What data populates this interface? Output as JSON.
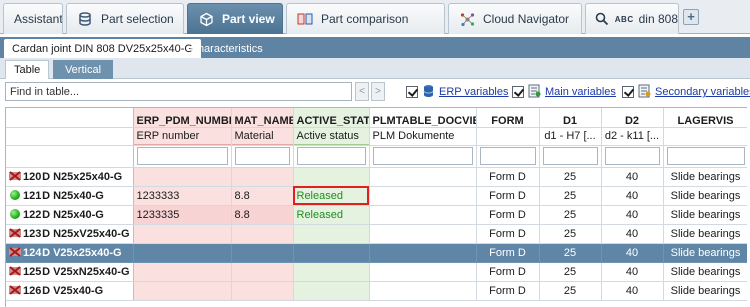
{
  "top_tabs": [
    {
      "label": "Assistant",
      "icon": "none"
    },
    {
      "label": "Part selection",
      "icon": "database-icon"
    },
    {
      "label": "Part view",
      "icon": "cube-icon"
    },
    {
      "label": "Part comparison",
      "icon": "compare-icon"
    },
    {
      "label": "Cloud Navigator",
      "icon": "network-icon"
    },
    {
      "label": "din 808",
      "prefix": "ABC",
      "icon": "search-icon"
    }
  ],
  "add_tab_label": "+",
  "doc_tabs": [
    {
      "label": "Cardan joint DIN 808 DV25x25x40-G"
    },
    {
      "label": "Characteristics"
    }
  ],
  "view_tabs": [
    {
      "label": "Table"
    },
    {
      "label": "Vertical"
    }
  ],
  "search": {
    "placeholder": "Find in table..."
  },
  "nav": {
    "prev": "<",
    "next": ">"
  },
  "options": [
    {
      "label": "ERP variables",
      "checked": true,
      "icon": "erp-db-icon"
    },
    {
      "label": "Main variables",
      "checked": true,
      "icon": "main-vars-icon"
    },
    {
      "label": "Secondary variables",
      "checked": true,
      "icon": "secondary-vars-icon"
    }
  ],
  "table": {
    "columns": [
      {
        "name": "ERP_PDM_NUMBER",
        "desc": "ERP number"
      },
      {
        "name": "MAT_NAME",
        "desc": "Material"
      },
      {
        "name": "ACTIVE_STATE",
        "desc": "Active status"
      },
      {
        "name": "PLMTABLE_DOCVIEW",
        "desc": "PLM Dokumente"
      },
      {
        "name": "FORM",
        "desc": ""
      },
      {
        "name": "D1",
        "desc": "d1 - H7 [..."
      },
      {
        "name": "D2",
        "desc": "d2 - k11 [..."
      },
      {
        "name": "LAGERVIS",
        "desc": ""
      }
    ],
    "rows": [
      {
        "num": "120",
        "status": "invalid",
        "name": "D N25x25x40-G",
        "erp": "",
        "mat": "",
        "state": "",
        "plm": "",
        "form": "Form D",
        "d1": "25",
        "d2": "40",
        "lager": "Slide bearings"
      },
      {
        "num": "121",
        "status": "ok",
        "name": "D N25x40-G",
        "erp": "1233333",
        "mat": "8.8",
        "state": "Released",
        "plm": "",
        "form": "Form D",
        "d1": "25",
        "d2": "40",
        "lager": "Slide bearings"
      },
      {
        "num": "122",
        "status": "ok",
        "name": "D N25x40-G",
        "erp": "1233335",
        "mat": "8.8",
        "state": "Released",
        "plm": "",
        "form": "Form D",
        "d1": "25",
        "d2": "40",
        "lager": "Slide bearings"
      },
      {
        "num": "123",
        "status": "invalid",
        "name": "D N25xV25x40-G",
        "erp": "",
        "mat": "",
        "state": "",
        "plm": "",
        "form": "Form D",
        "d1": "25",
        "d2": "40",
        "lager": "Slide bearings"
      },
      {
        "num": "124",
        "status": "invalid",
        "name": "D V25x25x40-G",
        "erp": "",
        "mat": "",
        "state": "",
        "plm": "",
        "form": "Form D",
        "d1": "25",
        "d2": "40",
        "lager": "Slide bearings"
      },
      {
        "num": "125",
        "status": "invalid",
        "name": "D V25xN25x40-G",
        "erp": "",
        "mat": "",
        "state": "",
        "plm": "",
        "form": "Form D",
        "d1": "25",
        "d2": "40",
        "lager": "Slide bearings"
      },
      {
        "num": "126",
        "status": "invalid",
        "name": "D V25x40-G",
        "erp": "",
        "mat": "",
        "state": "",
        "plm": "",
        "form": "Form D",
        "d1": "25",
        "d2": "40",
        "lager": "Slide bearings"
      }
    ]
  },
  "colors": {
    "accent": "#5f84a3",
    "selected_row": "#5f86a6",
    "erp_highlight": "#fbe0e0",
    "state_highlight": "#e6f2e0",
    "released_text": "#1f8f1f",
    "focus_outline": "#e02020"
  }
}
